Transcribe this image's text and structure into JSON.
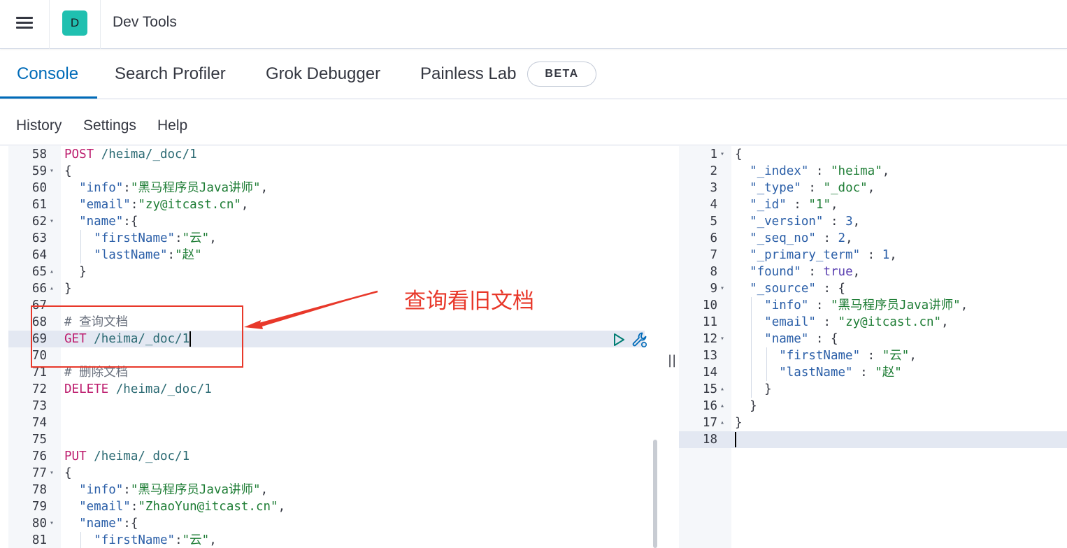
{
  "header": {
    "app_title": "Dev Tools",
    "space_avatar": "D"
  },
  "tabs": [
    {
      "label": "Console",
      "active": true
    },
    {
      "label": "Search Profiler",
      "active": false
    },
    {
      "label": "Grok Debugger",
      "active": false
    },
    {
      "label": "Painless Lab",
      "active": false
    }
  ],
  "beta_badge": "BETA",
  "subnav": [
    {
      "label": "History"
    },
    {
      "label": "Settings"
    },
    {
      "label": "Help"
    }
  ],
  "request_editor": {
    "lines": [
      {
        "n": "58",
        "fold": "",
        "text": "POST /heima/_doc/1"
      },
      {
        "n": "59",
        "fold": "▾",
        "text": "{"
      },
      {
        "n": "60",
        "fold": "",
        "text": "  \"info\":\"黑马程序员Java讲师\","
      },
      {
        "n": "61",
        "fold": "",
        "text": "  \"email\":\"zy@itcast.cn\","
      },
      {
        "n": "62",
        "fold": "▾",
        "text": "  \"name\":{"
      },
      {
        "n": "63",
        "fold": "",
        "text": "    \"firstName\":\"云\","
      },
      {
        "n": "64",
        "fold": "",
        "text": "    \"lastName\":\"赵\""
      },
      {
        "n": "65",
        "fold": "▴",
        "text": "  }"
      },
      {
        "n": "66",
        "fold": "▴",
        "text": "}"
      },
      {
        "n": "67",
        "fold": "",
        "text": ""
      },
      {
        "n": "68",
        "fold": "",
        "text": "# 查询文档"
      },
      {
        "n": "69",
        "fold": "",
        "text": "GET /heima/_doc/1"
      },
      {
        "n": "70",
        "fold": "",
        "text": ""
      },
      {
        "n": "71",
        "fold": "",
        "text": "# 删除文档"
      },
      {
        "n": "72",
        "fold": "",
        "text": "DELETE /heima/_doc/1"
      },
      {
        "n": "73",
        "fold": "",
        "text": ""
      },
      {
        "n": "74",
        "fold": "",
        "text": ""
      },
      {
        "n": "75",
        "fold": "",
        "text": ""
      },
      {
        "n": "76",
        "fold": "",
        "text": "PUT /heima/_doc/1"
      },
      {
        "n": "77",
        "fold": "▾",
        "text": "{"
      },
      {
        "n": "78",
        "fold": "",
        "text": "  \"info\":\"黑马程序员Java讲师\","
      },
      {
        "n": "79",
        "fold": "",
        "text": "  \"email\":\"ZhaoYun@itcast.cn\","
      },
      {
        "n": "80",
        "fold": "▾",
        "text": "  \"name\":{"
      },
      {
        "n": "81",
        "fold": "",
        "text": "    \"firstName\":\"云\","
      }
    ],
    "active_line": "69"
  },
  "response_editor": {
    "lines": [
      {
        "n": "1",
        "fold": "▾",
        "text": "{"
      },
      {
        "n": "2",
        "fold": "",
        "text": "  \"_index\" : \"heima\","
      },
      {
        "n": "3",
        "fold": "",
        "text": "  \"_type\" : \"_doc\","
      },
      {
        "n": "4",
        "fold": "",
        "text": "  \"_id\" : \"1\","
      },
      {
        "n": "5",
        "fold": "",
        "text": "  \"_version\" : 3,"
      },
      {
        "n": "6",
        "fold": "",
        "text": "  \"_seq_no\" : 2,"
      },
      {
        "n": "7",
        "fold": "",
        "text": "  \"_primary_term\" : 1,"
      },
      {
        "n": "8",
        "fold": "",
        "text": "  \"found\" : true,"
      },
      {
        "n": "9",
        "fold": "▾",
        "text": "  \"_source\" : {"
      },
      {
        "n": "10",
        "fold": "",
        "text": "    \"info\" : \"黑马程序员Java讲师\","
      },
      {
        "n": "11",
        "fold": "",
        "text": "    \"email\" : \"zy@itcast.cn\","
      },
      {
        "n": "12",
        "fold": "▾",
        "text": "    \"name\" : {"
      },
      {
        "n": "13",
        "fold": "",
        "text": "      \"firstName\" : \"云\","
      },
      {
        "n": "14",
        "fold": "",
        "text": "      \"lastName\" : \"赵\""
      },
      {
        "n": "15",
        "fold": "▴",
        "text": "    }"
      },
      {
        "n": "16",
        "fold": "▴",
        "text": "  }"
      },
      {
        "n": "17",
        "fold": "▴",
        "text": "}"
      },
      {
        "n": "18",
        "fold": "",
        "text": ""
      }
    ],
    "active_line": "18"
  },
  "annotation": {
    "text": "查询看旧文档",
    "color": "#e8382a"
  },
  "icons": {
    "menu": "hamburger-menu-icon",
    "run": "play-icon",
    "wrench": "wrench-icon",
    "resizer": "drag-handle-icon"
  },
  "colors": {
    "accent": "#006bb8",
    "method": "#bd1d6e",
    "string": "#1e7d35",
    "key": "#2b5fa8",
    "avatar": "#20c0b0"
  }
}
